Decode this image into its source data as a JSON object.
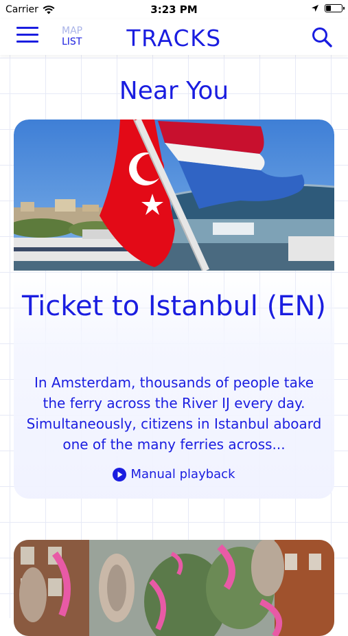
{
  "status_bar": {
    "carrier": "Carrier",
    "time": "3:23 PM",
    "battery_level": 0.35
  },
  "nav": {
    "map_label": "MAP",
    "list_label": "LIST",
    "title": "TRACKS"
  },
  "section": {
    "title": "Near You"
  },
  "tracks": [
    {
      "title": "Ticket to Istanbul (EN)",
      "description": "In Amsterdam, thousands of people take the ferry across the River IJ every day. Simultaneously, citizens in Istanbul aboard one of the many ferries across...",
      "playback_label": "Manual playback"
    }
  ],
  "colors": {
    "accent": "#1a1de0",
    "map_inactive": "#a9b3e8",
    "grid": "#e6e9f6"
  },
  "icons": {
    "wifi": "wifi-icon",
    "location": "location-arrow-icon",
    "battery": "battery-icon",
    "menu": "hamburger-menu-icon",
    "search": "search-icon",
    "play": "play-circle-icon"
  }
}
